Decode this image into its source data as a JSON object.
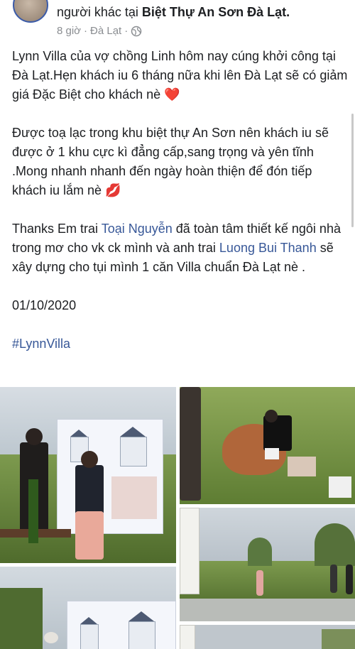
{
  "post": {
    "author_suffix": "người khác tại ",
    "location_name": "Biệt Thự An Sơn Đà Lạt.",
    "time": "8 giờ",
    "separator": "·",
    "city": "Đà Lạt",
    "separator2": "·",
    "privacy_icon": "globe-icon"
  },
  "body": {
    "p1": "Lynn Villa của vợ chồng Linh hôm nay cúng khởi công tại Đà Lạt.Hẹn khách iu 6 tháng nữa khi lên Đà Lạt sẽ có giảm giá Đặc Biệt cho khách nè",
    "p1_emoji": "❤️",
    "p2": "Được toạ lạc trong khu biệt thự An Sơn nên khách iu sẽ được ở 1 khu cực kì đẳng cấp,sang trọng và yên tĩnh .Mong nhanh nhanh đến ngày hoàn thiện để đón tiếp khách iu lắm nè",
    "p2_emoji": "💋",
    "p3_a": "Thanks Em trai ",
    "p3_mention1": "Toại Nguyễn",
    "p3_b": " đã toàn tâm thiết kế ngôi nhà trong mơ cho vk ck mình và anh trai ",
    "p3_mention2": "Luong Bui Thanh",
    "p3_c": " sẽ xây dựng cho tụi mình 1 căn Villa chuẩn Đà Lạt nè .",
    "date": "01/10/2020",
    "hashtag": "#LynnVilla"
  },
  "photos": [
    {
      "name": "ceremony-photo"
    },
    {
      "name": "digging-photo"
    },
    {
      "name": "site-photo"
    },
    {
      "name": "banner-photo"
    },
    {
      "name": "extra-photo"
    }
  ],
  "colors": {
    "link": "#385898",
    "text": "#1c1e21",
    "meta": "#8a8d91"
  }
}
